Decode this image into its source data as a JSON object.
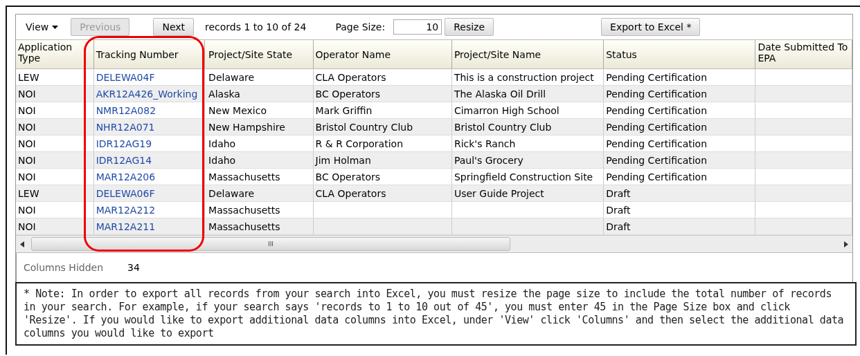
{
  "toolbar": {
    "view_menu": "View",
    "previous": {
      "label": "Previous",
      "disabled": true
    },
    "next": {
      "label": "Next",
      "disabled": false
    },
    "records": "records 1 to 10 of 24",
    "page_size_label": "Page Size:",
    "page_size_value": "10",
    "resize": "Resize",
    "export": "Export to Excel *"
  },
  "table": {
    "columns": [
      "Application Type",
      "Tracking Number",
      "Project/Site State",
      "Operator Name",
      "Project/Site Name",
      "Status",
      "Date Submitted To EPA"
    ],
    "rows": [
      {
        "application_type": "LEW",
        "tracking_number": "DELEWA04F",
        "state": "Delaware",
        "operator": "CLA Operators",
        "site": "This is a construction project",
        "status": "Pending Certification"
      },
      {
        "application_type": "NOI",
        "tracking_number": "AKR12A426_Working",
        "state": "Alaska",
        "operator": "BC Operators",
        "site": "The Alaska Oil Drill",
        "status": "Pending Certification"
      },
      {
        "application_type": "NOI",
        "tracking_number": "NMR12A082",
        "state": "New Mexico",
        "operator": "Mark Griffin",
        "site": "Cimarron High School",
        "status": "Pending Certification"
      },
      {
        "application_type": "NOI",
        "tracking_number": "NHR12A071",
        "state": "New Hampshire",
        "operator": "Bristol Country Club",
        "site": "Bristol Country Club",
        "status": "Pending Certification"
      },
      {
        "application_type": "NOI",
        "tracking_number": "IDR12AG19",
        "state": "Idaho",
        "operator": "R & R Corporation",
        "site": "Rick's Ranch",
        "status": "Pending Certification"
      },
      {
        "application_type": "NOI",
        "tracking_number": "IDR12AG14",
        "state": "Idaho",
        "operator": "Jim Holman",
        "site": "Paul's Grocery",
        "status": "Pending Certification"
      },
      {
        "application_type": "NOI",
        "tracking_number": "MAR12A206",
        "state": "Massachusetts",
        "operator": "BC Operators",
        "site": "Springfield Construction Site",
        "status": "Pending Certification"
      },
      {
        "application_type": "LEW",
        "tracking_number": "DELEWA06F",
        "state": "Delaware",
        "operator": "CLA Operators",
        "site": "User Guide Project",
        "status": "Draft"
      },
      {
        "application_type": "NOI",
        "tracking_number": "MAR12A212",
        "state": "Massachusetts",
        "status": "Draft"
      },
      {
        "application_type": "NOI",
        "tracking_number": "MAR12A211",
        "state": "Massachusetts",
        "status": "Draft"
      }
    ]
  },
  "scrollbar_grip": "III",
  "columns_hidden": {
    "label": "Columns Hidden",
    "value": "34"
  },
  "note": "* Note: In order to export all records from your search into Excel, you must resize the page size to include the total number of records in your search. For example, if your search says 'records to 1 to 10 out of 45', you must enter 45 in the Page Size box and click 'Resize'. If you would like to export additional data columns into Excel, under 'View' click 'Columns' and then select the additional data columns you would like to export"
}
